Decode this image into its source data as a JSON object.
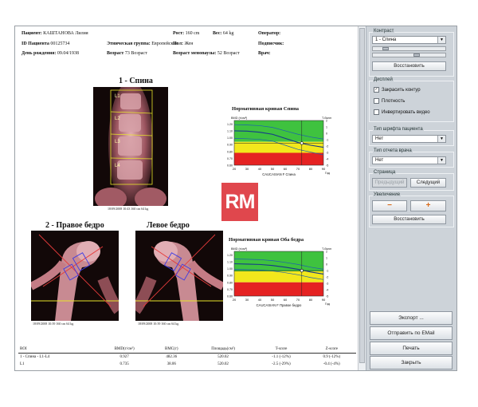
{
  "header": {
    "patient_label": "Пациент:",
    "patient_value": "КАШТАНОВА Лилия",
    "height_label": "Рост:",
    "height_value": "160 cm",
    "weight_label": "Вес:",
    "weight_value": "64 kg",
    "operator_label": "Оператор:",
    "patient_id_label": "ID Пациента",
    "patient_id_value": "00125734",
    "ethnic_label": "Этническая группа:",
    "ethnic_value": "Европейская",
    "sex_label": "Пол:",
    "sex_value": "Жен",
    "signature_label": "Подписчик:",
    "dob_label": "День рождения:",
    "dob_value": "09.04/1938",
    "age_label": "Возраст",
    "age_value": "73 Возраст",
    "menopause_label": "Возраст менопаузы:",
    "menopause_value": "52 Возраст",
    "doctor_label": "Врач:"
  },
  "spine": {
    "title": "1 - Спина",
    "caption": "18/09/2008 10:43 160 cm 64 kg",
    "vertebra_labels": [
      "L1",
      "L2",
      "L3",
      "L4"
    ]
  },
  "hip_right": {
    "title": "2 - Правое бедро",
    "caption": "18/09/2008 10:39 160 cm 64 kg"
  },
  "hip_left": {
    "title": "Левое бедро",
    "caption": "18/09/2008 10:39 160 cm 64 kg"
  },
  "chart_data": [
    {
      "type": "line",
      "title": "Нормативная кривая Спина",
      "ylabel": "BMD (г/см²)",
      "y2label": "T-балл",
      "xlabel": "Год",
      "x": [
        20,
        30,
        40,
        50,
        60,
        70,
        80,
        90
      ],
      "x_ticks": [
        "20",
        "30",
        "40",
        "50",
        "60",
        "70",
        "80",
        "90"
      ],
      "y_ticks": [
        "1.20",
        "1.10",
        "1.00",
        "0.90",
        "0.80",
        "0.70",
        "0.60"
      ],
      "y2_ticks": [
        "2",
        "1",
        "0",
        "-1",
        "-2",
        "-3",
        "-4",
        "-5"
      ],
      "ylim": [
        0.6,
        1.25
      ],
      "zones": {
        "normal_above": 0.94,
        "osteopenia_above": 0.78
      },
      "zone_colors": {
        "normal": "#3fc23f",
        "osteopenia": "#f2e71c",
        "osteoporosis": "#e52222"
      },
      "series": [
        {
          "values": [
            1.1,
            1.095,
            1.08,
            1.05,
            0.99,
            0.93,
            0.89,
            0.86
          ],
          "color": "#15398a"
        },
        {
          "values": [
            1.19,
            1.185,
            1.175,
            1.15,
            1.1,
            1.05,
            1.01,
            0.98
          ],
          "color": "#1c5fb0"
        },
        {
          "values": [
            0.99,
            0.985,
            0.975,
            0.95,
            0.89,
            0.83,
            0.79,
            0.75
          ],
          "color": "#1c5fb0"
        }
      ],
      "patient_point": {
        "x": 73,
        "y": 0.92
      },
      "footer": "CAUCASIAN F Спина"
    },
    {
      "type": "line",
      "title": "Нормативная кривая Оба бедра",
      "ylabel": "BMD (г/см²)",
      "y2label": "T-балл",
      "xlabel": "Год",
      "x": [
        20,
        30,
        40,
        50,
        60,
        70,
        80,
        90
      ],
      "x_ticks": [
        "20",
        "30",
        "40",
        "50",
        "60",
        "70",
        "80",
        "90"
      ],
      "y_ticks": [
        "1.20",
        "1.10",
        "1.00",
        "0.90",
        "0.80",
        "0.70",
        "0.60"
      ],
      "y2_ticks": [
        "2",
        "1",
        "0",
        "-1",
        "-2",
        "-3",
        "-4",
        "-5"
      ],
      "ylim": [
        0.6,
        1.25
      ],
      "zones": {
        "normal_above": 0.96,
        "osteopenia_above": 0.8
      },
      "zone_colors": {
        "normal": "#3fc23f",
        "osteopenia": "#f2e71c",
        "osteoporosis": "#e52222"
      },
      "series": [
        {
          "values": [
            1.07,
            1.065,
            1.06,
            1.045,
            1.02,
            0.99,
            0.95,
            0.92
          ],
          "color": "#15398a"
        },
        {
          "values": [
            1.14,
            1.135,
            1.13,
            1.115,
            1.09,
            1.06,
            1.02,
            0.99
          ],
          "color": "#1c5fb0"
        },
        {
          "values": [
            0.99,
            0.985,
            0.98,
            0.965,
            0.94,
            0.91,
            0.87,
            0.84
          ],
          "color": "#1c5fb0"
        }
      ],
      "patient_point": {
        "x": 73,
        "y": 0.97
      },
      "footer": "CAUCASIAN F Правое бедро"
    }
  ],
  "results": {
    "columns": [
      "ROI",
      "BMD(г/см²)",
      "BMC(г)",
      "Площадь(см²)",
      "T-score",
      "Z-score"
    ],
    "rows": [
      [
        "1 - Спина - L1-L4",
        "0.927",
        "482.36",
        "520.02",
        "-1.1 (-12%)",
        "0.9 (-12%)"
      ],
      [
        "L1",
        "0.735",
        "38.06",
        "520.02",
        "-2.5 (-29%)",
        "-0.4 (-4%)"
      ]
    ]
  },
  "sidebar": {
    "contrast_label": "Контраст",
    "contrast_select": "1 - Спина",
    "contrast_slider": 0.15,
    "brightness_slider": 0.62,
    "restore1": "Восстановить",
    "display_label": "Дисплей",
    "check_contour": "Закрасить контур",
    "check_density": "Плотность",
    "check_invert": "Инвертировать видео",
    "font_label": "Тип шрифта пациента",
    "font_select": "Нет",
    "report_label": "Тип отчета врача",
    "report_select": "Нет",
    "page_label": "Страница",
    "prev_button": "Предыдущий",
    "next_button": "Следущий",
    "zoom_label": "Увеличение",
    "zoom_out": "−",
    "zoom_in": "+",
    "restore2": "Восстановить",
    "export": "Экспорт ...",
    "email": "Отправить по EMail",
    "print": "Печать",
    "close": "Закрыть"
  },
  "watermark": "RM"
}
